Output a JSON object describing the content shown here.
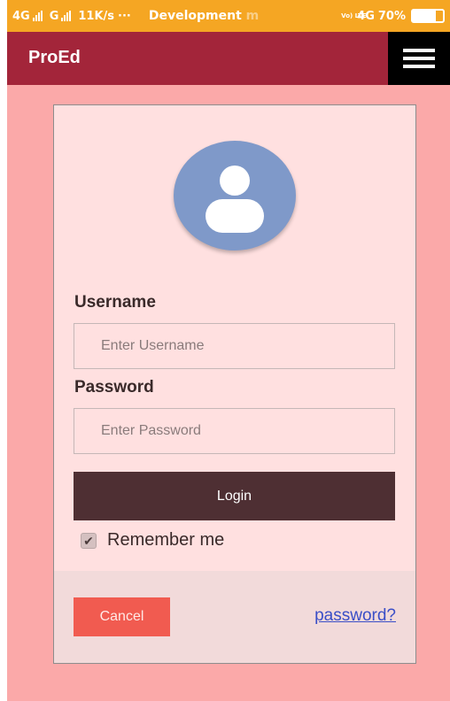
{
  "status_bar": {
    "network1": "4G",
    "network2": "G",
    "speed": "11K/s",
    "dots": "···",
    "app_title": "Development",
    "app_title_fade": "m",
    "volte": "Vo) LTE",
    "network3": "4G",
    "battery": "70%"
  },
  "app_bar": {
    "brand": "ProEd",
    "menu_icon": "hamburger-menu-icon"
  },
  "login_form": {
    "avatar_icon": "user-avatar-icon",
    "username_label": "Username",
    "username_placeholder": "Enter Username",
    "username_value": "",
    "password_label": "Password",
    "password_placeholder": "Enter Password",
    "password_value": "",
    "login_label": "Login",
    "remember_label": "Remember me",
    "remember_checked": true,
    "cancel_label": "Cancel",
    "forgot_label": "password?"
  },
  "colors": {
    "status_bar": "#f5a623",
    "app_bar": "#a3253a",
    "page_background": "#fba9a9",
    "card_background": "#ffe0e0",
    "login_button": "#4e2f33",
    "cancel_button": "#f15b50",
    "link": "#3a4ec7",
    "avatar": "#7f99c9"
  }
}
